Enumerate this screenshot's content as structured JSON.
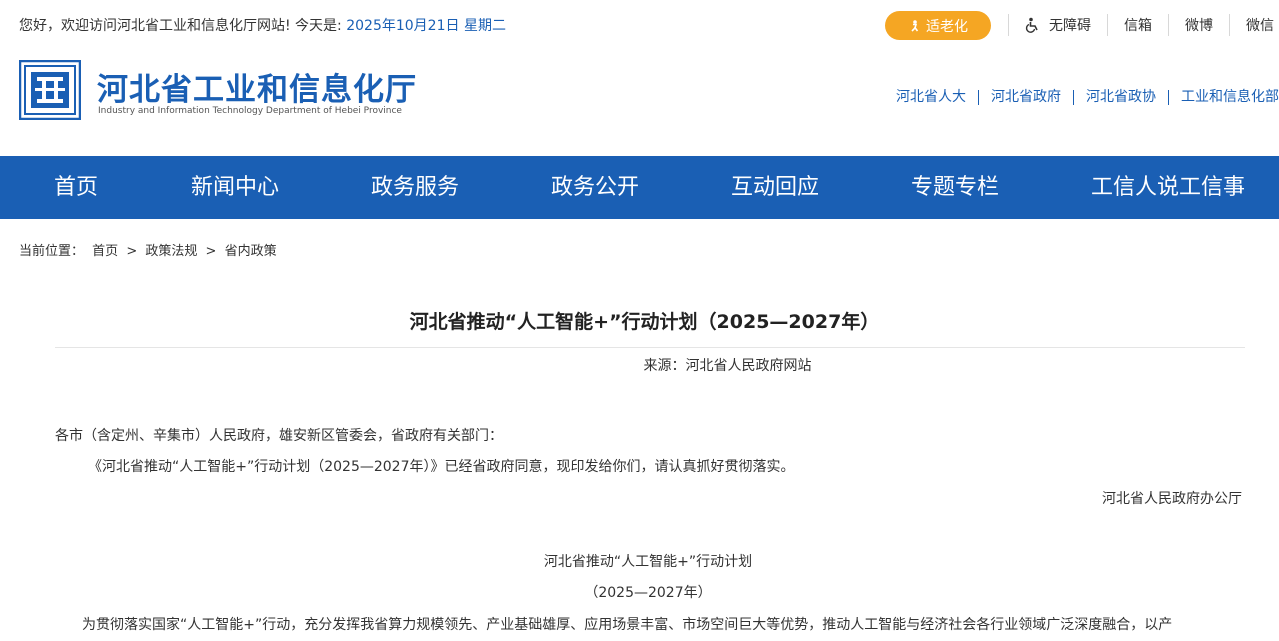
{
  "topbar": {
    "greeting_prefix": "您好，欢迎访问河北省工业和信息化厅网站! 今天是:",
    "greeting_date": "2025年10月21日 星期二",
    "elder_mode_label": "适老化",
    "links": [
      "无障碍",
      "信箱",
      "微博",
      "微信"
    ]
  },
  "header": {
    "site_name_cn": "河北省工业和信息化厅",
    "site_name_en": "Industry and Information Technology Department of Hebei Province",
    "related_links": [
      "河北省人大",
      "河北省政府",
      "河北省政协",
      "工业和信息化部"
    ]
  },
  "nav": {
    "items": [
      "首页",
      "新闻中心",
      "政务服务",
      "政务公开",
      "互动回应",
      "专题专栏",
      "工信人说工信事"
    ]
  },
  "breadcrumb": {
    "label": "当前位置：",
    "items": [
      "首页",
      ">",
      "政策法规",
      ">",
      "省内政策"
    ]
  },
  "article": {
    "title": "河北省推动“人工智能+”行动计划（2025—2027年）",
    "source": "来源：河北省人民政府网站",
    "addressee": "各市（含定州、辛集市）人民政府，雄安新区管委会，省政府有关部门：",
    "notice": "《河北省推动“人工智能+”行动计划（2025—2027年）》已经省政府同意，现印发给你们，请认真抓好贯彻落实。",
    "issuer": "河北省人民政府办公厅",
    "doc_title": "河北省推动“人工智能+”行动计划",
    "doc_subtitle": "（2025—2027年）",
    "body_first_line": "为贯彻落实国家“人工智能+”行动，充分发挥我省算力规模领先、产业基础雄厚、应用场景丰富、市场空间巨大等优势，推动人工智能与经济社会各行业领域广泛深度融合，以产"
  },
  "colors": {
    "brand_blue": "#1a5fb4",
    "elder_orange": "#f5a623"
  }
}
